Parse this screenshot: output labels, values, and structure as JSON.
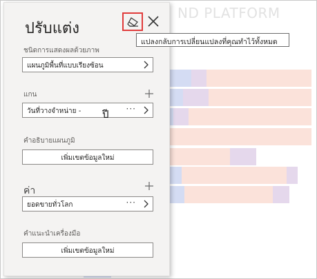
{
  "background": {
    "title_fragment": "ND PLATFORM"
  },
  "panel": {
    "title": "ปรับแต่ง",
    "eraser_tooltip": "แปลงกลับการเปลี่ยนแปลงที่คุณทำไว้ทั้งหมด",
    "visual_type": {
      "label": "ชนิดการแสดงผลด้วยภาพ",
      "value": "แผนภูมิพื้นที่แบบเรียงซ้อน"
    },
    "axis": {
      "label": "แกน",
      "value": "วันที่วางจำหน่าย - ",
      "cursor_text": "ปี"
    },
    "legend": {
      "label": "คำอธิบายแผนภูมิ",
      "button_label": "เพิ่มเขตข้อมูลใหม่"
    },
    "values": {
      "label": "ค่า",
      "value": "ยอดขายทั่วโลก"
    },
    "tooltips": {
      "label": "คำแนะนำเครื่องมือ",
      "button_label": "เพิ่มเขตข้อมูลใหม่"
    },
    "more_options_glyph": "···"
  },
  "colors": {
    "panel_bg": "#f4f3f2",
    "eraser_highlight": "#e03a3a",
    "bar_blue": "#d4dcf3",
    "bar_salmon": "#fbe2da",
    "bar_purple": "#e5d8ec"
  }
}
